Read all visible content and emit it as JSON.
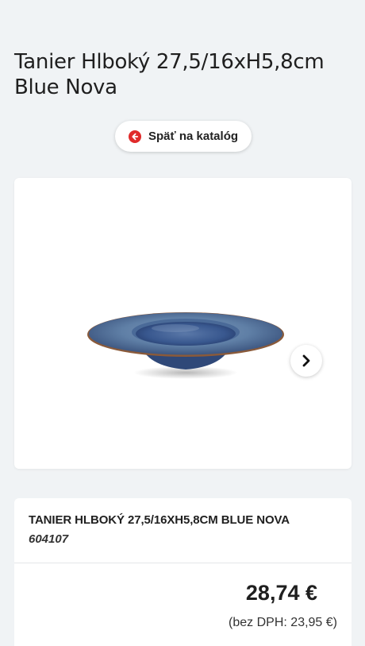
{
  "page": {
    "title": "Tanier Hlboký 27,5/16xH5,8cm Blue Nova"
  },
  "back_button": {
    "label": "Späť na katalóg",
    "icon": "arrow-left-circle-icon",
    "icon_color": "#e02a2a"
  },
  "gallery": {
    "image_alt": "Blue Nova deep plate",
    "next_icon": "chevron-right-icon"
  },
  "product": {
    "name": "TANIER HLBOKÝ 27,5/16XH5,8CM BLUE NOVA",
    "code": "604107",
    "price": "28,74 €",
    "price_net": "(bez DPH: 23,95 €)"
  },
  "colors": {
    "background": "#f0f3f5",
    "card": "#ffffff",
    "accent": "#e02a2a"
  }
}
